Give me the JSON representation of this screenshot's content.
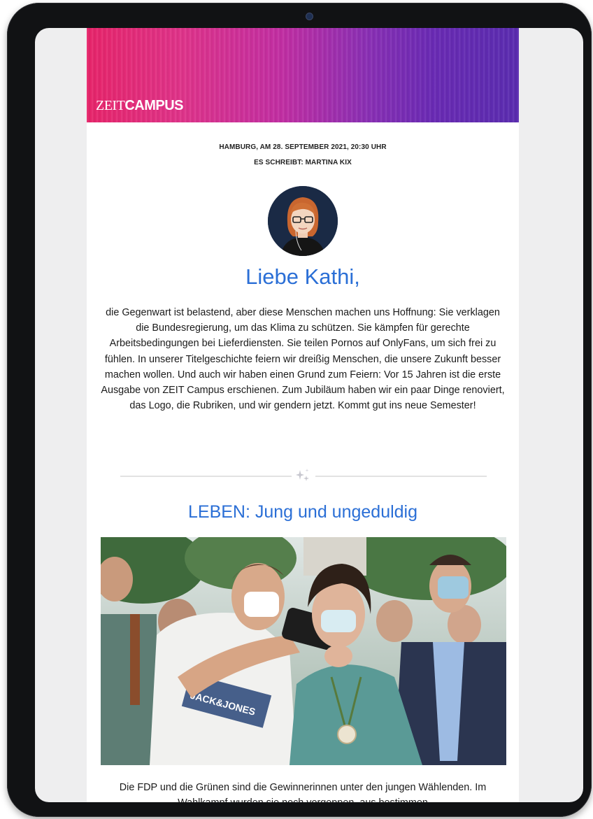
{
  "newsletter": {
    "brand_logo": {
      "part1": "ZEIT",
      "part2": "CAMPUS"
    },
    "dateline": "HAMBURG, AM 28. SEPTEMBER 2021, 20:30 UHR",
    "byline": "ES SCHREIBT: MARTINA KIX",
    "greeting": "Liebe Kathi,",
    "intro_text": "die Gegenwart ist belastend, aber diese Menschen machen uns Hoffnung: Sie verklagen die Bundesregierung, um das Klima zu schützen. Sie kämpfen für gerechte Arbeitsbedingungen bei Lieferdiensten. Sie teilen Pornos auf OnlyFans, um sich frei zu fühlen. In unserer Titelgeschichte feiern wir dreißig Menschen, die unsere Zukunft besser machen wollen. Und auch wir haben einen Grund zum Feiern: Vor 15 Jahren ist die erste Ausgabe von ZEIT Campus erschienen. Zum Jubiläum haben wir ein paar Dinge renoviert, das Logo, die Rubriken, und wir gendern jetzt. Kommt gut ins neue Semester!",
    "section_title": "LEBEN: Jung und ungeduldig",
    "photo_shirt_text": "JACK&JONES",
    "caption": "Die FDP und die Grünen sind die Gewinnerinnen unter den jungen Wählenden. Im Wahlkampf wurden sie noch vorgeppen, aus bestimmen"
  },
  "icons": {
    "divider": "sparkle-icon",
    "camera": "camera-dot-icon"
  },
  "colors": {
    "accent_blue": "#2b6fd6",
    "banner_start": "#e8246a",
    "banner_end": "#5a2cb0",
    "device_frame": "#111214"
  }
}
